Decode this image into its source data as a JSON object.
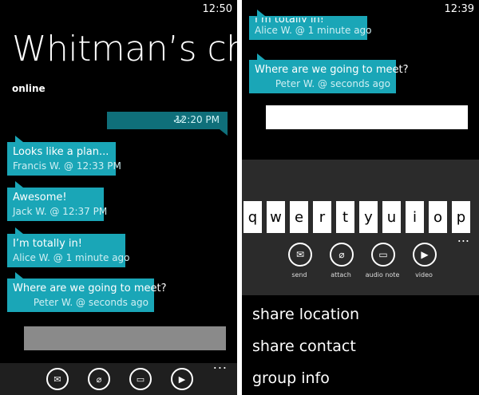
{
  "left": {
    "clock": "12:50",
    "title": "Whitman’s chat",
    "status": "online",
    "sent_time": "12:20 PM",
    "messages": [
      {
        "text": "Looks like a plan...",
        "meta": "Francis W. @ 12:33 PM"
      },
      {
        "text": "Awesome!",
        "meta": "Jack W. @ 12:37 PM"
      },
      {
        "text": "I’m totally in!",
        "meta": "Alice W. @ 1 minute ago"
      },
      {
        "text": "Where are we going to meet?",
        "meta": "Peter W. @ seconds ago"
      }
    ],
    "appbar_more": "..."
  },
  "right": {
    "clock": "12:39",
    "messages": [
      {
        "text": "I’m totally in!",
        "meta": "Alice W. @ 1 minute ago"
      },
      {
        "text": "Where are we going to meet?",
        "meta": "Peter W. @ seconds ago"
      }
    ],
    "keys": [
      "q",
      "w",
      "e",
      "r",
      "t",
      "y",
      "u",
      "i",
      "o",
      "p"
    ],
    "more": "...",
    "actions": [
      "send",
      "attach",
      "audio note",
      "video"
    ],
    "menu": [
      "share location",
      "share contact",
      "group info"
    ]
  },
  "colors": {
    "accent": "#1aa6b7",
    "sent": "#0f6f7a"
  }
}
